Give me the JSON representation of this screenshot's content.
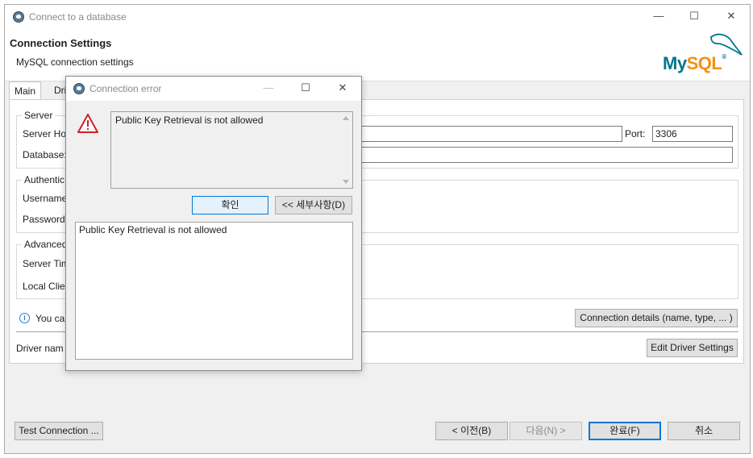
{
  "window": {
    "title": "Connect to a database",
    "minimize_label": "—",
    "maximize_label": "☐",
    "close_label": "✕"
  },
  "header": {
    "title": "Connection Settings",
    "subtitle": "MySQL connection settings",
    "logo_text_my": "My",
    "logo_text_sql": "SQL",
    "logo_trademark": "®"
  },
  "tabs": [
    {
      "label": "Main"
    },
    {
      "label": "Dri"
    }
  ],
  "server": {
    "group_title": "Server",
    "host_label": "Server Ho",
    "database_label": "Database:",
    "port_label": "Port:",
    "port_value": "3306",
    "host_value": "",
    "database_value": ""
  },
  "auth": {
    "group_title": "Authentic",
    "username_label": "Username",
    "password_label": "Password:"
  },
  "advanced": {
    "group_title": "Advanced",
    "timezone_label": "Server Tim",
    "client_label": "Local Clie"
  },
  "info": {
    "text": "You ca",
    "icon": "info-icon"
  },
  "driver": {
    "label": "Driver nam",
    "details_button": "Connection details (name, type, ... )",
    "edit_button": "Edit Driver Settings"
  },
  "footer": {
    "test_button": "Test Connection ...",
    "back_button": "< 이전(B)",
    "next_button": "다음(N) >",
    "finish_button": "완료(F)",
    "cancel_button": "취소"
  },
  "dialog": {
    "title": "Connection error",
    "minimize_label": "—",
    "maximize_label": "☐",
    "close_label": "✕",
    "message": "Public Key Retrieval is not allowed",
    "ok_button": "확인",
    "details_button": "<< 세부사항(D)",
    "details_text": "Public Key Retrieval is not allowed",
    "warning_icon": "warning-icon",
    "warning_color": "#d0202a"
  },
  "colors": {
    "accent": "#0078d7",
    "mysql_blue": "#00758f",
    "mysql_orange": "#f29111"
  }
}
